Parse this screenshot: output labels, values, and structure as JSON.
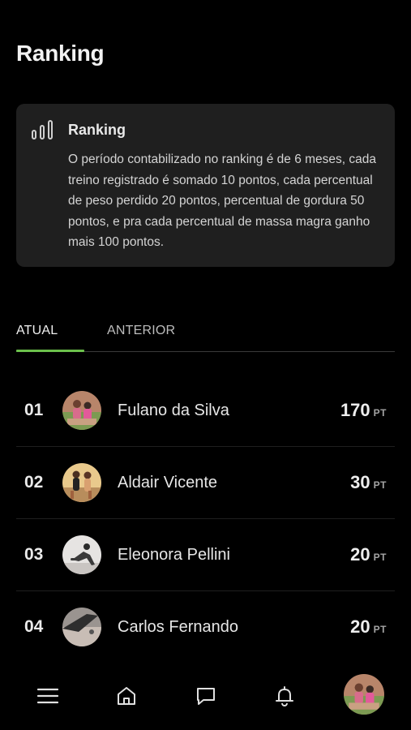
{
  "header": {
    "title": "Ranking"
  },
  "info_card": {
    "icon": "bar-chart-icon",
    "title": "Ranking",
    "text": "O período contabilizado no ranking é de 6 meses, cada treino registrado é somado 10 pontos, cada percentual de peso perdido 20 pontos, percentual de gordura 50 pontos, e pra cada percentual de massa magra ganho mais 100 pontos."
  },
  "tabs": [
    {
      "label": "ATUAL",
      "active": true
    },
    {
      "label": "ANTERIOR",
      "active": false
    }
  ],
  "accent_color": "#6bc04b",
  "ranking": [
    {
      "position": "01",
      "name": "Fulano da Silva",
      "points": "170",
      "unit": "PT"
    },
    {
      "position": "02",
      "name": "Aldair Vicente",
      "points": "30",
      "unit": "PT"
    },
    {
      "position": "03",
      "name": "Eleonora Pellini",
      "points": "20",
      "unit": "PT"
    },
    {
      "position": "04",
      "name": "Carlos Fernando",
      "points": "20",
      "unit": "PT"
    }
  ],
  "bottom_nav": [
    {
      "icon": "menu-icon"
    },
    {
      "icon": "home-icon"
    },
    {
      "icon": "chat-icon"
    },
    {
      "icon": "bell-icon"
    },
    {
      "icon": "profile-avatar"
    }
  ]
}
